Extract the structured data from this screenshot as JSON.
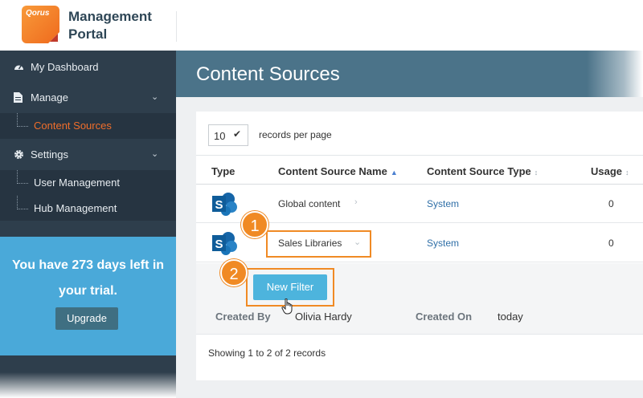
{
  "header": {
    "logo_text": "Qorus",
    "brand_line1": "Management",
    "brand_line2": "Portal"
  },
  "sidebar": {
    "items": [
      {
        "label": "My Dashboard",
        "icon": "dashboard-icon"
      },
      {
        "label": "Manage",
        "icon": "document-icon"
      },
      {
        "label": "Settings",
        "icon": "gear-icon"
      }
    ],
    "manage_sub": [
      {
        "label": "Content Sources",
        "active": true
      }
    ],
    "settings_sub": [
      {
        "label": "User Management"
      },
      {
        "label": "Hub Management"
      }
    ],
    "trial": {
      "prefix": "You have ",
      "days": "273",
      "suffix": " days left in your trial.",
      "upgrade_label": "Upgrade"
    }
  },
  "main": {
    "title": "Content Sources",
    "records_per_page_value": "10",
    "records_per_page_label": "records per page",
    "columns": [
      "Type",
      "Content Source Name",
      "Content Source Type",
      "Usage"
    ],
    "rows": [
      {
        "name": "Global content",
        "type": "System",
        "usage": "0",
        "icon": "sharepoint-icon"
      },
      {
        "name": "Sales Libraries",
        "type": "System",
        "usage": "0",
        "icon": "sharepoint-icon"
      }
    ],
    "detail": {
      "new_filter_label": "New Filter",
      "created_by_label": "Created By",
      "created_by_value": "Olivia Hardy",
      "created_on_label": "Created On",
      "created_on_value": "today"
    },
    "showing": "Showing 1 to 2 of 2 records"
  },
  "callouts": [
    "1",
    "2"
  ],
  "colors": {
    "accent": "#f08a24",
    "sidebar": "#2e3e4c",
    "header": "#4b7389",
    "trial": "#4aa9d9",
    "link": "#2f6fa7"
  }
}
